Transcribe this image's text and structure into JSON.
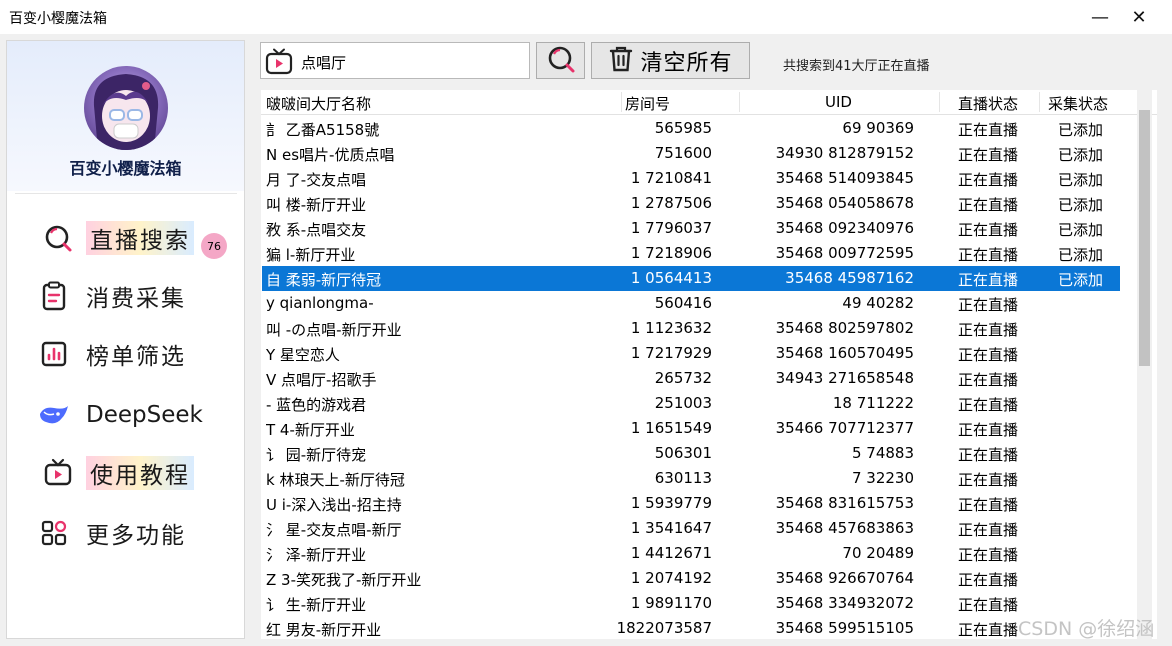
{
  "window": {
    "title": "百变小樱魔法箱",
    "minimize_glyph": "—",
    "close_glyph": "✕"
  },
  "sidebar": {
    "app_name": "百变小樱魔法箱",
    "badge_count": "76",
    "items": [
      {
        "label": "直播搜索",
        "icon": "search-icon",
        "highlighted": true
      },
      {
        "label": "消费采集",
        "icon": "clipboard-icon",
        "highlighted": false
      },
      {
        "label": "榜单筛选",
        "icon": "chart-icon",
        "highlighted": false
      },
      {
        "label": "DeepSeek",
        "icon": "whale-icon",
        "highlighted": false
      },
      {
        "label": "使用教程",
        "icon": "tv-icon",
        "highlighted": true
      },
      {
        "label": "更多功能",
        "icon": "apps-icon",
        "highlighted": false
      }
    ]
  },
  "toolbar": {
    "search_value": "点唱厅",
    "clear_label": "清空所有",
    "status_text": "共搜索到41大厅正在直播"
  },
  "table": {
    "columns": [
      "啵啵间大厅名称",
      "房间号",
      "UID",
      "直播状态",
      "采集状态"
    ],
    "rows": [
      {
        "name": "訁 乙番A5158號",
        "room": "565985",
        "uid": "69 90369",
        "live": "正在直播",
        "collect": "已添加"
      },
      {
        "name": "N es唱片-优质点唱",
        "room": "751600",
        "uid": "34930 812879152",
        "live": "正在直播",
        "collect": "已添加"
      },
      {
        "name": "月 了-交友点唱",
        "room": "1 7210841",
        "uid": "35468 514093845",
        "live": "正在直播",
        "collect": "已添加"
      },
      {
        "name": "叫 楼-新厅开业",
        "room": "1 2787506",
        "uid": "35468 054058678",
        "live": "正在直播",
        "collect": "已添加"
      },
      {
        "name": "敄 系-点唱交友",
        "room": "1 7796037",
        "uid": "35468 092340976",
        "live": "正在直播",
        "collect": "已添加"
      },
      {
        "name": "猵 l-新厅开业",
        "room": "1 7218906",
        "uid": "35468 009772595",
        "live": "正在直播",
        "collect": "已添加"
      },
      {
        "name": "自 柔弱-新厅待冠",
        "room": "1 0564413",
        "uid": "35468 45987162",
        "live": "正在直播",
        "collect": "已添加"
      },
      {
        "name": "y qianlongma-",
        "room": "560416",
        "uid": "49 40282",
        "live": "正在直播",
        "collect": ""
      },
      {
        "name": "叫 -の点唱-新厅开业",
        "room": "1 1123632",
        "uid": "35468 802597802",
        "live": "正在直播",
        "collect": ""
      },
      {
        "name": "Y 星空恋人",
        "room": "1 7217929",
        "uid": "35468 160570495",
        "live": "正在直播",
        "collect": ""
      },
      {
        "name": "V 点唱厅-招歌手",
        "room": "265732",
        "uid": "34943 271658548",
        "live": "正在直播",
        "collect": ""
      },
      {
        "name": "- 蓝色的游戏君",
        "room": "251003",
        "uid": "18 711222",
        "live": "正在直播",
        "collect": ""
      },
      {
        "name": "T 4-新厅开业",
        "room": "1 1651549",
        "uid": "35466 707712377",
        "live": "正在直播",
        "collect": ""
      },
      {
        "name": "讠 园-新厅待宠",
        "room": "506301",
        "uid": "5 74883",
        "live": "正在直播",
        "collect": ""
      },
      {
        "name": "k 林琅天上-新厅待冠",
        "room": "630113",
        "uid": "7 32230",
        "live": "正在直播",
        "collect": ""
      },
      {
        "name": "U i-深入浅出-招主持",
        "room": "1 5939779",
        "uid": "35468 831615753",
        "live": "正在直播",
        "collect": ""
      },
      {
        "name": "氵 星-交友点唱-新厅",
        "room": "1 3541647",
        "uid": "35468 457683863",
        "live": "正在直播",
        "collect": ""
      },
      {
        "name": "氵 泽-新厅开业",
        "room": "1 4412671",
        "uid": "70 20489",
        "live": "正在直播",
        "collect": ""
      },
      {
        "name": "Z 3-笑死我了-新厅开业",
        "room": "1 2074192",
        "uid": "35468 926670764",
        "live": "正在直播",
        "collect": ""
      },
      {
        "name": "讠 生-新厅开业",
        "room": "1 9891170",
        "uid": "35468 334932072",
        "live": "正在直播",
        "collect": ""
      },
      {
        "name": "红 男友-新厅开业",
        "room": "1822073587",
        "uid": "35468 599515105",
        "live": "正在直播",
        "collect": ""
      }
    ],
    "selected_row": 6
  },
  "watermark": "CSDN @徐绍涵",
  "colors": {
    "selection": "#0b77d6",
    "badge": "#f4a7c6",
    "accent_pink": "#e8336b"
  }
}
